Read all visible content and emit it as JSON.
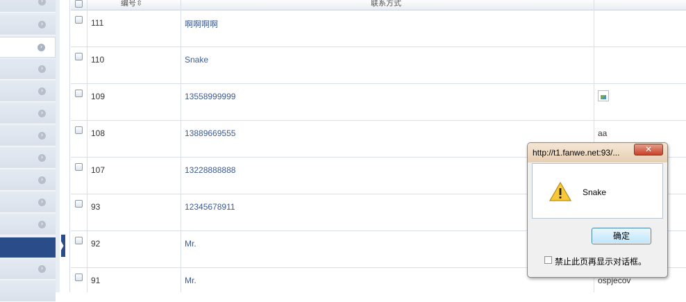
{
  "sidebar": {
    "items": [
      {
        "state": "normal"
      },
      {
        "state": "normal"
      },
      {
        "state": "highlight"
      },
      {
        "state": "normal"
      },
      {
        "state": "normal"
      },
      {
        "state": "normal"
      },
      {
        "state": "normal"
      },
      {
        "state": "normal"
      },
      {
        "state": "normal"
      },
      {
        "state": "normal"
      },
      {
        "state": "active"
      },
      {
        "state": "normal"
      },
      {
        "state": "normal"
      }
    ],
    "arrow_glyph": "›",
    "active_color": "#2a4c88"
  },
  "table": {
    "headers": {
      "id": "编号⇳",
      "contact": "联系方式"
    },
    "rows": [
      {
        "id": "111",
        "contact": "啊啊啊啊",
        "extra": ""
      },
      {
        "id": "110",
        "contact": "Snake",
        "extra": ""
      },
      {
        "id": "109",
        "contact": "13558999999",
        "extra": "",
        "broken_image": true
      },
      {
        "id": "108",
        "contact": "13889669555",
        "extra": "aa"
      },
      {
        "id": "107",
        "contact": "13228888888",
        "extra": ""
      },
      {
        "id": "93",
        "contact": "12345678911",
        "extra": ""
      },
      {
        "id": "92",
        "contact": "Mr.",
        "extra": ""
      },
      {
        "id": "91",
        "contact": "Mr.",
        "extra": "ospjecov"
      }
    ]
  },
  "dialog": {
    "title": "http://t1.fanwe.net:93/...",
    "close_glyph": "✕",
    "message": "Snake",
    "ok_label": "确定",
    "suppress_label": "禁止此页再显示对话框。",
    "suppress_checked": false,
    "icon": "warning-icon"
  }
}
